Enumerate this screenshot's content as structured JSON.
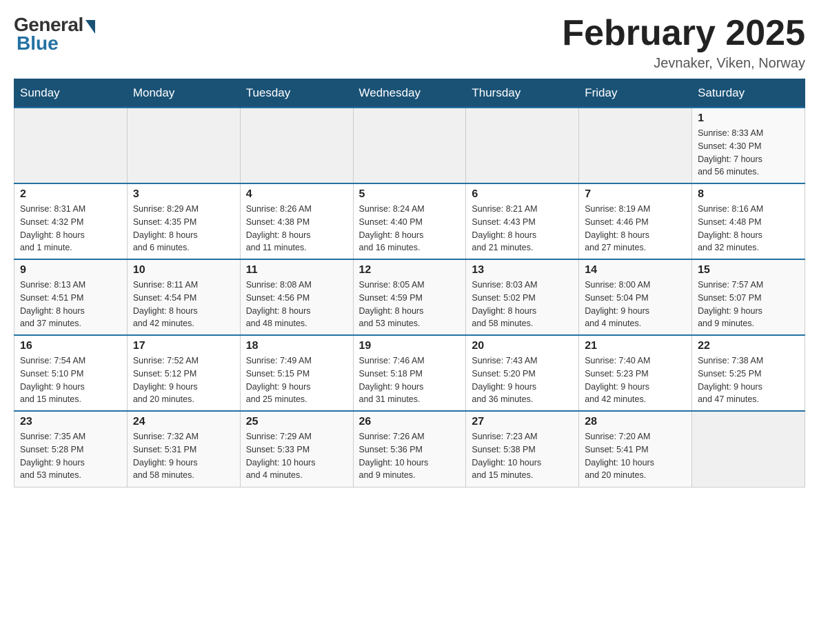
{
  "header": {
    "logo_general": "General",
    "logo_blue": "Blue",
    "month_title": "February 2025",
    "location": "Jevnaker, Viken, Norway"
  },
  "weekdays": [
    "Sunday",
    "Monday",
    "Tuesday",
    "Wednesday",
    "Thursday",
    "Friday",
    "Saturday"
  ],
  "weeks": [
    [
      {
        "day": "",
        "info": ""
      },
      {
        "day": "",
        "info": ""
      },
      {
        "day": "",
        "info": ""
      },
      {
        "day": "",
        "info": ""
      },
      {
        "day": "",
        "info": ""
      },
      {
        "day": "",
        "info": ""
      },
      {
        "day": "1",
        "info": "Sunrise: 8:33 AM\nSunset: 4:30 PM\nDaylight: 7 hours\nand 56 minutes."
      }
    ],
    [
      {
        "day": "2",
        "info": "Sunrise: 8:31 AM\nSunset: 4:32 PM\nDaylight: 8 hours\nand 1 minute."
      },
      {
        "day": "3",
        "info": "Sunrise: 8:29 AM\nSunset: 4:35 PM\nDaylight: 8 hours\nand 6 minutes."
      },
      {
        "day": "4",
        "info": "Sunrise: 8:26 AM\nSunset: 4:38 PM\nDaylight: 8 hours\nand 11 minutes."
      },
      {
        "day": "5",
        "info": "Sunrise: 8:24 AM\nSunset: 4:40 PM\nDaylight: 8 hours\nand 16 minutes."
      },
      {
        "day": "6",
        "info": "Sunrise: 8:21 AM\nSunset: 4:43 PM\nDaylight: 8 hours\nand 21 minutes."
      },
      {
        "day": "7",
        "info": "Sunrise: 8:19 AM\nSunset: 4:46 PM\nDaylight: 8 hours\nand 27 minutes."
      },
      {
        "day": "8",
        "info": "Sunrise: 8:16 AM\nSunset: 4:48 PM\nDaylight: 8 hours\nand 32 minutes."
      }
    ],
    [
      {
        "day": "9",
        "info": "Sunrise: 8:13 AM\nSunset: 4:51 PM\nDaylight: 8 hours\nand 37 minutes."
      },
      {
        "day": "10",
        "info": "Sunrise: 8:11 AM\nSunset: 4:54 PM\nDaylight: 8 hours\nand 42 minutes."
      },
      {
        "day": "11",
        "info": "Sunrise: 8:08 AM\nSunset: 4:56 PM\nDaylight: 8 hours\nand 48 minutes."
      },
      {
        "day": "12",
        "info": "Sunrise: 8:05 AM\nSunset: 4:59 PM\nDaylight: 8 hours\nand 53 minutes."
      },
      {
        "day": "13",
        "info": "Sunrise: 8:03 AM\nSunset: 5:02 PM\nDaylight: 8 hours\nand 58 minutes."
      },
      {
        "day": "14",
        "info": "Sunrise: 8:00 AM\nSunset: 5:04 PM\nDaylight: 9 hours\nand 4 minutes."
      },
      {
        "day": "15",
        "info": "Sunrise: 7:57 AM\nSunset: 5:07 PM\nDaylight: 9 hours\nand 9 minutes."
      }
    ],
    [
      {
        "day": "16",
        "info": "Sunrise: 7:54 AM\nSunset: 5:10 PM\nDaylight: 9 hours\nand 15 minutes."
      },
      {
        "day": "17",
        "info": "Sunrise: 7:52 AM\nSunset: 5:12 PM\nDaylight: 9 hours\nand 20 minutes."
      },
      {
        "day": "18",
        "info": "Sunrise: 7:49 AM\nSunset: 5:15 PM\nDaylight: 9 hours\nand 25 minutes."
      },
      {
        "day": "19",
        "info": "Sunrise: 7:46 AM\nSunset: 5:18 PM\nDaylight: 9 hours\nand 31 minutes."
      },
      {
        "day": "20",
        "info": "Sunrise: 7:43 AM\nSunset: 5:20 PM\nDaylight: 9 hours\nand 36 minutes."
      },
      {
        "day": "21",
        "info": "Sunrise: 7:40 AM\nSunset: 5:23 PM\nDaylight: 9 hours\nand 42 minutes."
      },
      {
        "day": "22",
        "info": "Sunrise: 7:38 AM\nSunset: 5:25 PM\nDaylight: 9 hours\nand 47 minutes."
      }
    ],
    [
      {
        "day": "23",
        "info": "Sunrise: 7:35 AM\nSunset: 5:28 PM\nDaylight: 9 hours\nand 53 minutes."
      },
      {
        "day": "24",
        "info": "Sunrise: 7:32 AM\nSunset: 5:31 PM\nDaylight: 9 hours\nand 58 minutes."
      },
      {
        "day": "25",
        "info": "Sunrise: 7:29 AM\nSunset: 5:33 PM\nDaylight: 10 hours\nand 4 minutes."
      },
      {
        "day": "26",
        "info": "Sunrise: 7:26 AM\nSunset: 5:36 PM\nDaylight: 10 hours\nand 9 minutes."
      },
      {
        "day": "27",
        "info": "Sunrise: 7:23 AM\nSunset: 5:38 PM\nDaylight: 10 hours\nand 15 minutes."
      },
      {
        "day": "28",
        "info": "Sunrise: 7:20 AM\nSunset: 5:41 PM\nDaylight: 10 hours\nand 20 minutes."
      },
      {
        "day": "",
        "info": ""
      }
    ]
  ]
}
